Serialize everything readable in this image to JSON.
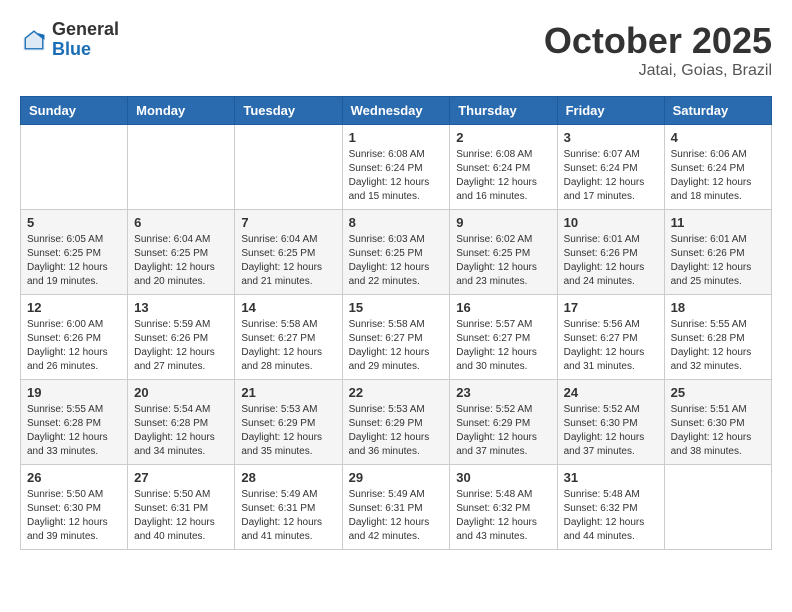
{
  "header": {
    "logo_general": "General",
    "logo_blue": "Blue",
    "month_title": "October 2025",
    "location": "Jatai, Goias, Brazil"
  },
  "days_of_week": [
    "Sunday",
    "Monday",
    "Tuesday",
    "Wednesday",
    "Thursday",
    "Friday",
    "Saturday"
  ],
  "weeks": [
    [
      {
        "day": "",
        "info": ""
      },
      {
        "day": "",
        "info": ""
      },
      {
        "day": "",
        "info": ""
      },
      {
        "day": "1",
        "info": "Sunrise: 6:08 AM\nSunset: 6:24 PM\nDaylight: 12 hours\nand 15 minutes."
      },
      {
        "day": "2",
        "info": "Sunrise: 6:08 AM\nSunset: 6:24 PM\nDaylight: 12 hours\nand 16 minutes."
      },
      {
        "day": "3",
        "info": "Sunrise: 6:07 AM\nSunset: 6:24 PM\nDaylight: 12 hours\nand 17 minutes."
      },
      {
        "day": "4",
        "info": "Sunrise: 6:06 AM\nSunset: 6:24 PM\nDaylight: 12 hours\nand 18 minutes."
      }
    ],
    [
      {
        "day": "5",
        "info": "Sunrise: 6:05 AM\nSunset: 6:25 PM\nDaylight: 12 hours\nand 19 minutes."
      },
      {
        "day": "6",
        "info": "Sunrise: 6:04 AM\nSunset: 6:25 PM\nDaylight: 12 hours\nand 20 minutes."
      },
      {
        "day": "7",
        "info": "Sunrise: 6:04 AM\nSunset: 6:25 PM\nDaylight: 12 hours\nand 21 minutes."
      },
      {
        "day": "8",
        "info": "Sunrise: 6:03 AM\nSunset: 6:25 PM\nDaylight: 12 hours\nand 22 minutes."
      },
      {
        "day": "9",
        "info": "Sunrise: 6:02 AM\nSunset: 6:25 PM\nDaylight: 12 hours\nand 23 minutes."
      },
      {
        "day": "10",
        "info": "Sunrise: 6:01 AM\nSunset: 6:26 PM\nDaylight: 12 hours\nand 24 minutes."
      },
      {
        "day": "11",
        "info": "Sunrise: 6:01 AM\nSunset: 6:26 PM\nDaylight: 12 hours\nand 25 minutes."
      }
    ],
    [
      {
        "day": "12",
        "info": "Sunrise: 6:00 AM\nSunset: 6:26 PM\nDaylight: 12 hours\nand 26 minutes."
      },
      {
        "day": "13",
        "info": "Sunrise: 5:59 AM\nSunset: 6:26 PM\nDaylight: 12 hours\nand 27 minutes."
      },
      {
        "day": "14",
        "info": "Sunrise: 5:58 AM\nSunset: 6:27 PM\nDaylight: 12 hours\nand 28 minutes."
      },
      {
        "day": "15",
        "info": "Sunrise: 5:58 AM\nSunset: 6:27 PM\nDaylight: 12 hours\nand 29 minutes."
      },
      {
        "day": "16",
        "info": "Sunrise: 5:57 AM\nSunset: 6:27 PM\nDaylight: 12 hours\nand 30 minutes."
      },
      {
        "day": "17",
        "info": "Sunrise: 5:56 AM\nSunset: 6:27 PM\nDaylight: 12 hours\nand 31 minutes."
      },
      {
        "day": "18",
        "info": "Sunrise: 5:55 AM\nSunset: 6:28 PM\nDaylight: 12 hours\nand 32 minutes."
      }
    ],
    [
      {
        "day": "19",
        "info": "Sunrise: 5:55 AM\nSunset: 6:28 PM\nDaylight: 12 hours\nand 33 minutes."
      },
      {
        "day": "20",
        "info": "Sunrise: 5:54 AM\nSunset: 6:28 PM\nDaylight: 12 hours\nand 34 minutes."
      },
      {
        "day": "21",
        "info": "Sunrise: 5:53 AM\nSunset: 6:29 PM\nDaylight: 12 hours\nand 35 minutes."
      },
      {
        "day": "22",
        "info": "Sunrise: 5:53 AM\nSunset: 6:29 PM\nDaylight: 12 hours\nand 36 minutes."
      },
      {
        "day": "23",
        "info": "Sunrise: 5:52 AM\nSunset: 6:29 PM\nDaylight: 12 hours\nand 37 minutes."
      },
      {
        "day": "24",
        "info": "Sunrise: 5:52 AM\nSunset: 6:30 PM\nDaylight: 12 hours\nand 37 minutes."
      },
      {
        "day": "25",
        "info": "Sunrise: 5:51 AM\nSunset: 6:30 PM\nDaylight: 12 hours\nand 38 minutes."
      }
    ],
    [
      {
        "day": "26",
        "info": "Sunrise: 5:50 AM\nSunset: 6:30 PM\nDaylight: 12 hours\nand 39 minutes."
      },
      {
        "day": "27",
        "info": "Sunrise: 5:50 AM\nSunset: 6:31 PM\nDaylight: 12 hours\nand 40 minutes."
      },
      {
        "day": "28",
        "info": "Sunrise: 5:49 AM\nSunset: 6:31 PM\nDaylight: 12 hours\nand 41 minutes."
      },
      {
        "day": "29",
        "info": "Sunrise: 5:49 AM\nSunset: 6:31 PM\nDaylight: 12 hours\nand 42 minutes."
      },
      {
        "day": "30",
        "info": "Sunrise: 5:48 AM\nSunset: 6:32 PM\nDaylight: 12 hours\nand 43 minutes."
      },
      {
        "day": "31",
        "info": "Sunrise: 5:48 AM\nSunset: 6:32 PM\nDaylight: 12 hours\nand 44 minutes."
      },
      {
        "day": "",
        "info": ""
      }
    ]
  ]
}
